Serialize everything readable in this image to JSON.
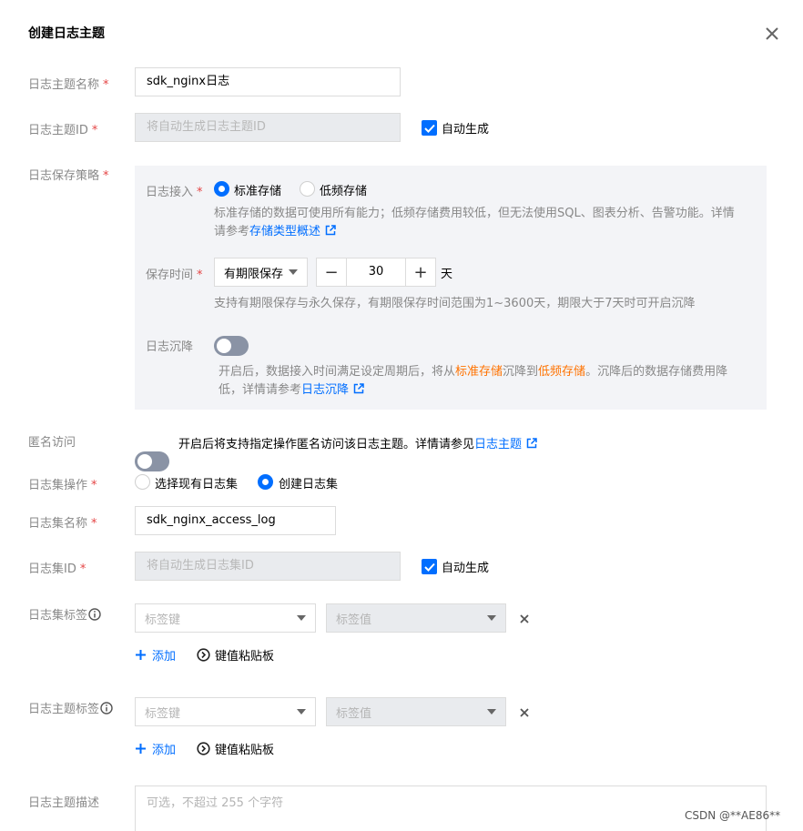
{
  "dialog": {
    "title": "创建日志主题"
  },
  "form": {
    "topic_name": {
      "label": "日志主题名称",
      "value": "sdk_nginx日志"
    },
    "topic_id": {
      "label": "日志主题ID",
      "placeholder": "将自动生成日志主题ID",
      "auto_label": "自动生成"
    },
    "storage_policy": {
      "label": "日志保存策略",
      "access": {
        "label": "日志接入",
        "options": [
          "标准存储",
          "低频存储"
        ],
        "selected": "标准存储",
        "hint_part1": "标准存储的数据可使用所有能力；低频存储费用较低，但无法使用SQL、图表分析、告警功能。详情",
        "hint_part2": "请参考",
        "hint_link": "存储类型概述"
      },
      "retention": {
        "label": "保存时间",
        "mode": "有期限保存",
        "value": "30",
        "unit": "天",
        "hint": "支持有期限保存与永久保存，有期限保存时间范围为1~3600天，期限大于7天时可开启沉降"
      },
      "sink": {
        "label": "日志沉降",
        "enabled": false,
        "hint_a": "开启后，数据接入时间满足设定周期后，将从",
        "hint_std": "标准存储",
        "hint_b": "沉降到",
        "hint_low": "低频存储",
        "hint_c": "。沉降后的数据存储费用降",
        "hint_d": "低，详情请参考",
        "hint_link": "日志沉降"
      }
    },
    "anonymous": {
      "label": "匿名访问",
      "enabled": false,
      "hint": "开启后将支持指定操作匿名访问该日志主题。详情请参见",
      "link": "日志主题"
    },
    "logset_op": {
      "label": "日志集操作",
      "options": [
        "选择现有日志集",
        "创建日志集"
      ],
      "selected": "创建日志集"
    },
    "logset_name": {
      "label": "日志集名称",
      "value": "sdk_nginx_access_log"
    },
    "logset_id": {
      "label": "日志集ID",
      "placeholder": "将自动生成日志集ID",
      "auto_label": "自动生成"
    },
    "logset_tags": {
      "label": "日志集标签",
      "key_placeholder": "标签键",
      "value_placeholder": "标签值",
      "add_label": "添加",
      "paste_label": "键值粘贴板"
    },
    "topic_tags": {
      "label": "日志主题标签",
      "key_placeholder": "标签键",
      "value_placeholder": "标签值",
      "add_label": "添加",
      "paste_label": "键值粘贴板"
    },
    "description": {
      "label": "日志主题描述",
      "placeholder": "可选，不超过 255 个字符"
    }
  },
  "watermark": "CSDN @**AE86**",
  "colors": {
    "primary": "#006eff",
    "required": "#e54545",
    "warning": "#ff7200"
  }
}
